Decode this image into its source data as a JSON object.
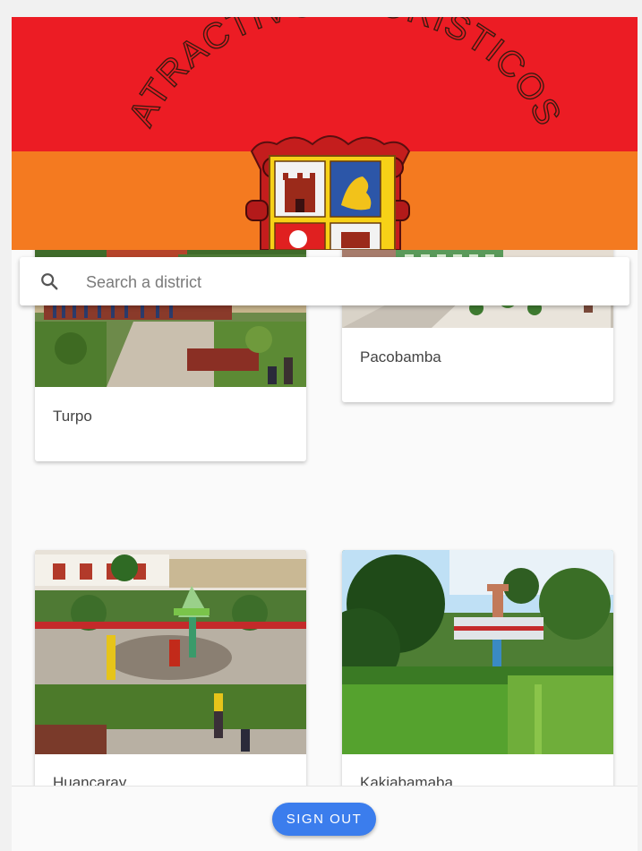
{
  "header": {
    "title": "ATRACTIVOS TURÍSTICOS",
    "colors": {
      "top": "#ec1c24",
      "bottom": "#f47a20"
    }
  },
  "search": {
    "icon": "search-icon",
    "placeholder": "Search a district"
  },
  "districts": [
    {
      "name": "Turpo"
    },
    {
      "name": "Pacobamba"
    },
    {
      "name": "Huancaray"
    },
    {
      "name": "Kakiabamaba"
    }
  ],
  "footer": {
    "signout_label": "SIGN OUT",
    "accent": "#3b7ded"
  }
}
